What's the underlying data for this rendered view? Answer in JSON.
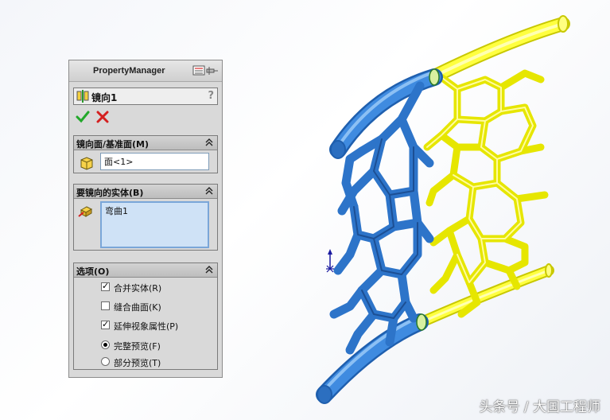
{
  "property_manager": {
    "title": "PropertyManager",
    "feature_name": "镜向1",
    "help": "?",
    "groups": {
      "mirror_face": {
        "title": "镜向面/基准面(M)",
        "value": "面<1>"
      },
      "bodies": {
        "title": "要镜向的实体(B)",
        "items": [
          "弯曲1"
        ]
      },
      "options": {
        "title": "选项(O)",
        "merge_solids": {
          "label": "合并实体(R)",
          "checked": true
        },
        "knit_surfaces": {
          "label": "缝合曲面(K)",
          "checked": false
        },
        "propagate_visual": {
          "label": "延伸视象属性(P)",
          "checked": true
        },
        "full_preview": {
          "label": "完整预览(F)",
          "selected": true
        },
        "partial_preview": {
          "label": "部分预览(T)",
          "selected": false
        }
      }
    }
  },
  "icons": {
    "ok": "check-icon",
    "cancel": "x-icon",
    "feature": "mirror-feature-icon",
    "face": "face-cube-icon",
    "body": "body-selection-icon",
    "collapse": "double-chevron-up-icon",
    "pin": "pushpin-icon"
  },
  "colors": {
    "original_body": "#3f8be0",
    "mirrored_body": "#ffff33",
    "ok": "#22a82a",
    "cancel": "#d42020"
  },
  "watermark": "头条号 / 大国工程师"
}
